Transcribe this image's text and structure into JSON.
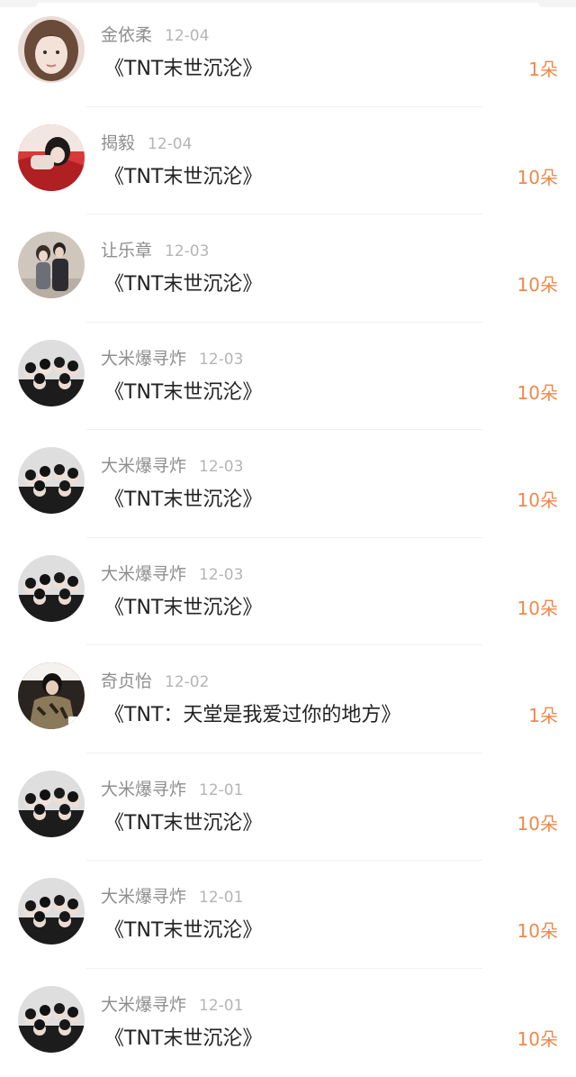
{
  "accent_color": "#f0884a",
  "records": [
    {
      "avatar": "girl-selfie",
      "sender": "金依柔",
      "date": "12-04",
      "gift": "《TNT末世沉沦》",
      "amount": "1朵"
    },
    {
      "avatar": "girl-red-lying",
      "sender": "揭毅",
      "date": "12-04",
      "gift": "《TNT末世沉沦》",
      "amount": "10朵"
    },
    {
      "avatar": "couple-standing",
      "sender": "让乐章",
      "date": "12-03",
      "gift": "《TNT末世沉沦》",
      "amount": "10朵"
    },
    {
      "avatar": "group-photo",
      "sender": "大米爆寻炸",
      "date": "12-03",
      "gift": "《TNT末世沉沦》",
      "amount": "10朵"
    },
    {
      "avatar": "group-photo",
      "sender": "大米爆寻炸",
      "date": "12-03",
      "gift": "《TNT末世沉沦》",
      "amount": "10朵"
    },
    {
      "avatar": "group-photo",
      "sender": "大米爆寻炸",
      "date": "12-03",
      "gift": "《TNT末世沉沦》",
      "amount": "10朵"
    },
    {
      "avatar": "dark-jacket-boy",
      "sender": "奇贞怡",
      "date": "12-02",
      "gift": "《TNT：天堂是我爱过你的地方》",
      "amount": "1朵"
    },
    {
      "avatar": "group-photo",
      "sender": "大米爆寻炸",
      "date": "12-01",
      "gift": "《TNT末世沉沦》",
      "amount": "10朵"
    },
    {
      "avatar": "group-photo",
      "sender": "大米爆寻炸",
      "date": "12-01",
      "gift": "《TNT末世沉沦》",
      "amount": "10朵"
    },
    {
      "avatar": "group-photo",
      "sender": "大米爆寻炸",
      "date": "12-01",
      "gift": "《TNT末世沉沦》",
      "amount": "10朵"
    }
  ]
}
